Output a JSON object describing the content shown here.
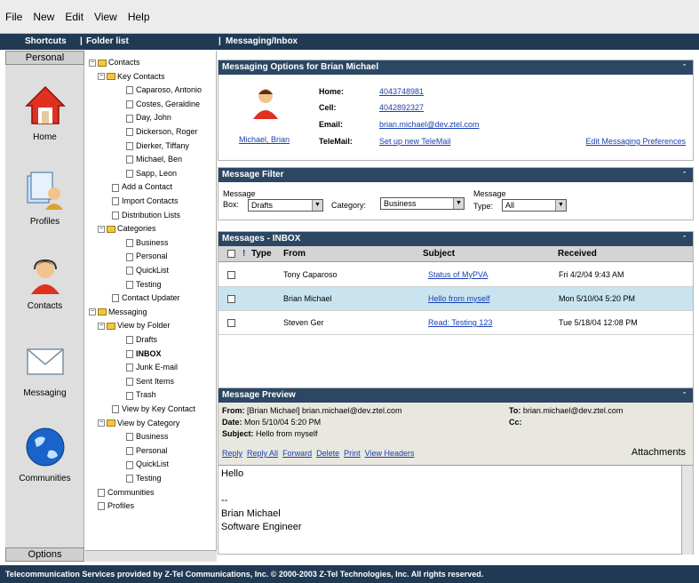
{
  "menu": [
    "File",
    "New",
    "Edit",
    "View",
    "Help"
  ],
  "header": {
    "shortcuts": "Shortcuts",
    "folder_list": "Folder list",
    "path": "Messaging/Inbox"
  },
  "sidebar": {
    "personal_tab": "Personal",
    "options_tab": "Options",
    "items": [
      {
        "label": "Home",
        "icon": "home-icon"
      },
      {
        "label": "Profiles",
        "icon": "profiles-icon"
      },
      {
        "label": "Contacts",
        "icon": "contacts-icon"
      },
      {
        "label": "Messaging",
        "icon": "messaging-icon"
      },
      {
        "label": "Communities",
        "icon": "communities-icon"
      }
    ]
  },
  "tree": [
    {
      "label": "Contacts",
      "toggle": "⊟",
      "folder": true
    },
    {
      "label": "Key Contacts",
      "toggle": "⊟",
      "folder": true
    },
    {
      "label": "Caparoso, Antonio"
    },
    {
      "label": "Costes, Geraldine"
    },
    {
      "label": "Day, John"
    },
    {
      "label": "Dickerson, Roger"
    },
    {
      "label": "Dierker, Tiffany"
    },
    {
      "label": "Michael, Ben"
    },
    {
      "label": "Sapp, Leon"
    },
    {
      "label": "Add a Contact"
    },
    {
      "label": "Import Contacts"
    },
    {
      "label": "Distribution Lists"
    },
    {
      "label": "Categories",
      "toggle": "⊟",
      "folder": true
    },
    {
      "label": "Business"
    },
    {
      "label": "Personal"
    },
    {
      "label": "QuickList"
    },
    {
      "label": "Testing"
    },
    {
      "label": "Contact Updater"
    },
    {
      "label": "Messaging",
      "toggle": "⊟",
      "folder": true
    },
    {
      "label": "View by Folder",
      "toggle": "⊟",
      "folder": true
    },
    {
      "label": "Drafts"
    },
    {
      "label": "INBOX",
      "bold": true
    },
    {
      "label": "Junk E-mail"
    },
    {
      "label": "Sent Items"
    },
    {
      "label": "Trash"
    },
    {
      "label": "View by Key Contact"
    },
    {
      "label": "View by Category",
      "toggle": "⊟",
      "folder": true
    },
    {
      "label": "Business"
    },
    {
      "label": "Personal"
    },
    {
      "label": "QuickList"
    },
    {
      "label": "Testing"
    },
    {
      "label": "Communities"
    },
    {
      "label": "Profiles"
    }
  ],
  "options_panel": {
    "title": "Messaging Options for Brian Michael",
    "name_link": "Michael, Brian",
    "home_label": "Home:",
    "home_value": "4043748981",
    "cell_label": "Cell:",
    "cell_value": "4042892327",
    "email_label": "Email:",
    "email_value": "brian.michael@dev.ztel.com",
    "telemail_label": "TeleMail:",
    "telemail_value": "Set up new TeleMail",
    "edit_link": "Edit Messaging Preferences"
  },
  "filter_panel": {
    "title": "Message Filter",
    "box_label_1": "Message",
    "box_label_2": "Box:",
    "box_value": "Drafts",
    "category_label": "Category:",
    "category_value": "Business",
    "type_label_1": "Message",
    "type_label_2": "Type:",
    "type_value": "All"
  },
  "messages_panel": {
    "title": "Messages - INBOX",
    "columns": {
      "flag": "!",
      "type": "Type",
      "from": "From",
      "subject": "Subject",
      "received": "Received"
    },
    "rows": [
      {
        "from": "Tony Caparoso",
        "subject": "Status of MyPVA",
        "received": "Fri 4/2/04 9:43 AM",
        "selected": false
      },
      {
        "from": "Brian Michael",
        "subject": "Hello from myself",
        "received": "Mon 5/10/04 5:20 PM",
        "selected": true
      },
      {
        "from": "Steven Ger",
        "subject": "Read: Testing 123",
        "received": "Tue 5/18/04 12:08 PM",
        "selected": false
      }
    ]
  },
  "preview_panel": {
    "title": "Message Preview",
    "from_label": "From:",
    "from_value": "[Brian Michael] brian.michael@dev.ztel.com",
    "to_label": "To:",
    "to_value": "brian.michael@dev.ztel.com",
    "date_label": "Date:",
    "date_value": "Mon 5/10/04 5:20 PM",
    "cc_label": "Cc:",
    "subject_label": "Subject:",
    "subject_value": "Hello from myself",
    "actions": [
      "Reply",
      "Reply All",
      "Forward",
      "Delete",
      "Print",
      "View Headers"
    ],
    "attachments_label": "Attachments",
    "body_lines": [
      "Hello",
      "",
      "--",
      "Brian Michael",
      "Software Engineer"
    ]
  },
  "footer": "Telecommunication Services provided by Z-Tel Communications, Inc. © 2000-2003 Z-Tel Technologies, Inc. All rights reserved.",
  "colors": {
    "header": "#203a54",
    "panel_header": "#2b4763",
    "selected_row": "#c9e4ee",
    "link": "#1a3fb0"
  }
}
